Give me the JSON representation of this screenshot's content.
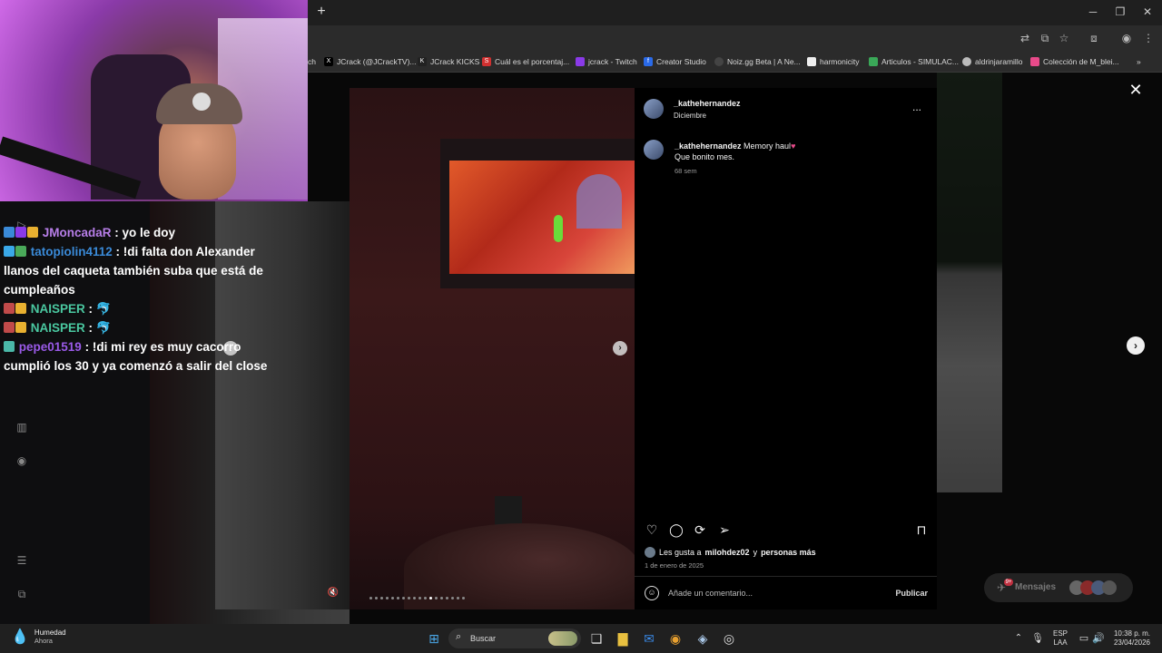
{
  "browser": {
    "new_tab": "+",
    "bookmarks": [
      {
        "label": "ch",
        "color": "#3a3a3a"
      },
      {
        "label": "JCrack (@JCrackTV)...",
        "color": "#000000",
        "icon": "X"
      },
      {
        "label": "JCrack KICKS",
        "color": "#111111",
        "icon": "K"
      },
      {
        "label": "Cuál es el porcentaj...",
        "color": "#d03030",
        "icon": "S"
      },
      {
        "label": "jcrack - Twitch",
        "color": "#8a3ae8",
        "icon": ""
      },
      {
        "label": "Creator Studio",
        "color": "#2a6ae8",
        "icon": "f"
      },
      {
        "label": "Noiz.gg Beta | A Ne...",
        "color": "#333333",
        "icon": ""
      },
      {
        "label": "harmonicity",
        "color": "#eeeeee",
        "icon": ""
      },
      {
        "label": "Articulos - SIMULAC...",
        "color": "#3aa858",
        "icon": ""
      },
      {
        "label": "aldrinjaramillo",
        "color": "#bbbbbb",
        "icon": ""
      },
      {
        "label": "Colección de M_blei...",
        "color": "#e84a8a",
        "icon": ""
      }
    ]
  },
  "chat": {
    "messages": [
      {
        "user": "JMoncadaR",
        "text": " : yo le doy"
      },
      {
        "user": "tatopiolin4112",
        "text": " : !di falta don Alexander llanos del caqueta también suba que está de cumpleaños"
      },
      {
        "user": "NAISPER",
        "text": " : 🐬"
      },
      {
        "user": "NAISPER",
        "text": " : 🐬"
      },
      {
        "user": "pepe01519",
        "text": " : !di mi rey es muy cacorro cumplió los 30 y ya comenzó a salir del close"
      }
    ]
  },
  "post": {
    "username": "_kathehernandez",
    "subtitle": "Diciembre",
    "caption_user": "_kathehernandez",
    "caption_text": " Memory haul",
    "caption_line2": "Que bonito mes.",
    "caption_time": "68 sem",
    "likes_prefix": "Les gusta a ",
    "likes_user": "milohdez02",
    "likes_mid": " y ",
    "likes_rest": "personas más",
    "date": "1 de enero de 2025",
    "comment_placeholder": "Añade un comentario...",
    "publish": "Publicar",
    "more": "...",
    "carousel_total": 18,
    "carousel_active": 11
  },
  "messages_pill": {
    "label": "Mensajes",
    "badge": "9+"
  },
  "taskbar": {
    "weather_title": "Humedad",
    "weather_sub": "Ahora",
    "search_label": "Buscar",
    "lang1": "ESP",
    "lang2": "LAA",
    "time": "10:38 p. m.",
    "date": "23/04/2026"
  }
}
